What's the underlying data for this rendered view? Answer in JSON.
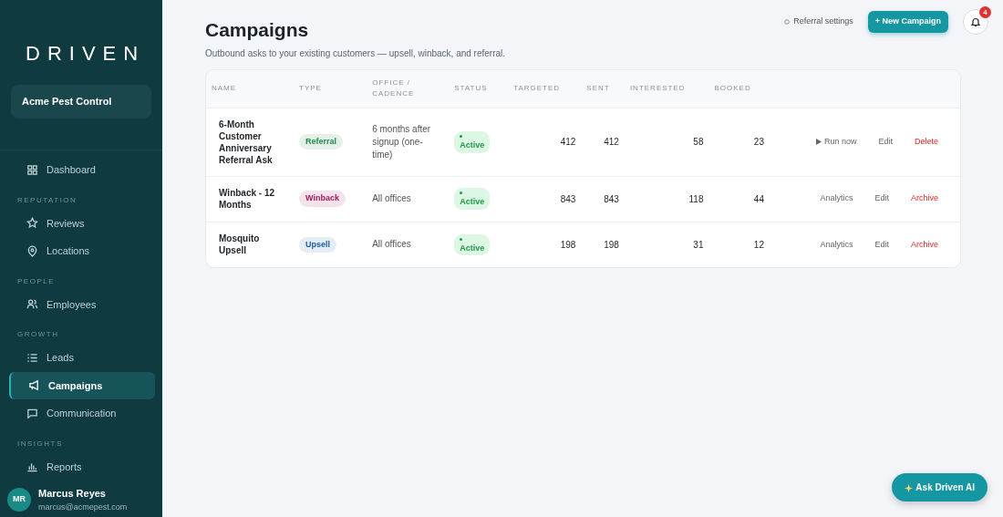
{
  "sidebar": {
    "logo": "DRIVEN",
    "account": "Acme Pest Control",
    "sections": [
      {
        "items": [
          {
            "label": "Dashboard",
            "selected": false
          }
        ]
      },
      {
        "heading": "REPUTATION",
        "items": [
          {
            "label": "Reviews",
            "selected": false
          },
          {
            "label": "Locations",
            "selected": false
          }
        ]
      },
      {
        "heading": "PEOPLE",
        "items": [
          {
            "label": "Employees",
            "selected": false
          }
        ]
      },
      {
        "heading": "GROWTH",
        "items": [
          {
            "label": "Leads",
            "selected": false
          },
          {
            "label": "Campaigns",
            "selected": true
          },
          {
            "label": "Communication",
            "selected": false
          }
        ]
      },
      {
        "heading": "INSIGHTS",
        "items": [
          {
            "label": "Reports",
            "selected": false
          }
        ]
      }
    ],
    "user": {
      "initials": "MR",
      "name": "Marcus Reyes",
      "email": "marcus@acmepest.com"
    }
  },
  "header": {
    "title": "Campaigns",
    "subtitle": "Outbound asks to your existing customers — upsell, winback, and referral.",
    "settings_link": "Referral settings",
    "new_button": "+ New Campaign",
    "notification_count": "4"
  },
  "table": {
    "columns": [
      "NAME",
      "TYPE",
      "OFFICE / CADENCE",
      "STATUS",
      "TARGETED",
      "SENT",
      "INTERESTED",
      "BOOKED"
    ],
    "rows": [
      {
        "name": "6-Month Customer Anniversary Referral Ask",
        "type": "Referral",
        "color": "#1f8a4c",
        "cadence": "6 months after signup (one-time)",
        "status": "Active",
        "targeted": "412",
        "sent": "412",
        "interested": "58",
        "booked": "23",
        "actions": [
          {
            "label": "Run now",
            "kind": "run"
          },
          {
            "label": "Edit",
            "kind": "plain"
          },
          {
            "label": "Delete",
            "kind": "danger"
          }
        ]
      },
      {
        "name": "Winback - 12 Months",
        "type": "Winback",
        "color": "#a3195b",
        "cadence": "All offices",
        "status": "Active",
        "targeted": "843",
        "sent": "843",
        "interested": "118",
        "booked": "44",
        "actions": [
          {
            "label": "Analytics",
            "kind": "plain"
          },
          {
            "label": "Edit",
            "kind": "plain"
          },
          {
            "label": "Archive",
            "kind": "danger"
          }
        ]
      },
      {
        "name": "Mosquito Upsell",
        "type": "Upsell",
        "color": "#1d5fa8",
        "cadence": "All offices",
        "status": "Active",
        "targeted": "198",
        "sent": "198",
        "interested": "31",
        "booked": "12",
        "actions": [
          {
            "label": "Analytics",
            "kind": "plain"
          },
          {
            "label": "Edit",
            "kind": "plain"
          },
          {
            "label": "Archive",
            "kind": "danger"
          }
        ]
      }
    ]
  },
  "ai_button": "Ask Driven AI"
}
